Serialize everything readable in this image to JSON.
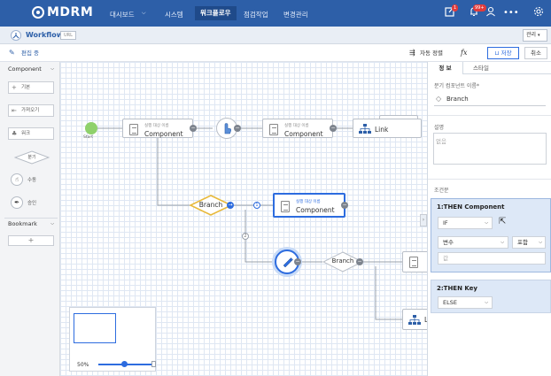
{
  "topbar": {
    "logo": "MDRM",
    "menu": [
      "대시보드",
      "시스템",
      "워크플로우",
      "점검작업",
      "변경관리"
    ],
    "active_menu": "워크플로우",
    "notification_badge": "1",
    "alert_badge": "99+"
  },
  "subbar": {
    "title": "Workflow",
    "tag": "URL",
    "right_select": "관리"
  },
  "toolbar": {
    "mode": "편집 중",
    "auto_align": "자동 정렬",
    "fx": "fx",
    "save": "저장",
    "cancel": "취소"
  },
  "palette": {
    "section_title": "Component",
    "items": [
      "기본",
      "가져오기",
      "워크",
      "분기",
      "수동",
      "승인"
    ],
    "bookmark_title": "Bookmark",
    "add": "+"
  },
  "canvas": {
    "start_label": "Start",
    "nodes": [
      {
        "sub": "실행 대상 이름",
        "main": "Component"
      },
      {
        "sub": "실행 대상 이름",
        "main": "Component"
      },
      {
        "sub": "",
        "main": "Link"
      },
      {
        "sub": "실행 대상 이름",
        "main": "Component"
      }
    ],
    "branch_labels": [
      "Branch",
      "Branch"
    ],
    "edge_badges": [
      "1",
      "2"
    ],
    "partial_label": "L",
    "zoom": "50%"
  },
  "right_panel": {
    "tabs": [
      "정 보",
      "스타일"
    ],
    "branch_name_label": "분기 컴포넌트 이름*",
    "branch_name_value": "Branch",
    "desc_label": "설명",
    "desc_placeholder": "없음",
    "condition_label": "조건문",
    "cond1_title": "1:THEN Component",
    "cond1_select": "IF",
    "cond1_var": "변수",
    "cond1_op": "포함",
    "cond1_value_placeholder": "값",
    "cond2_title": "2:THEN Key",
    "cond2_select": "ELSE"
  },
  "colors": {
    "topbar": "#2d5fa8",
    "accent": "#2d6cdf",
    "branch_border": "#e8b93a",
    "start": "#8fd16b"
  }
}
